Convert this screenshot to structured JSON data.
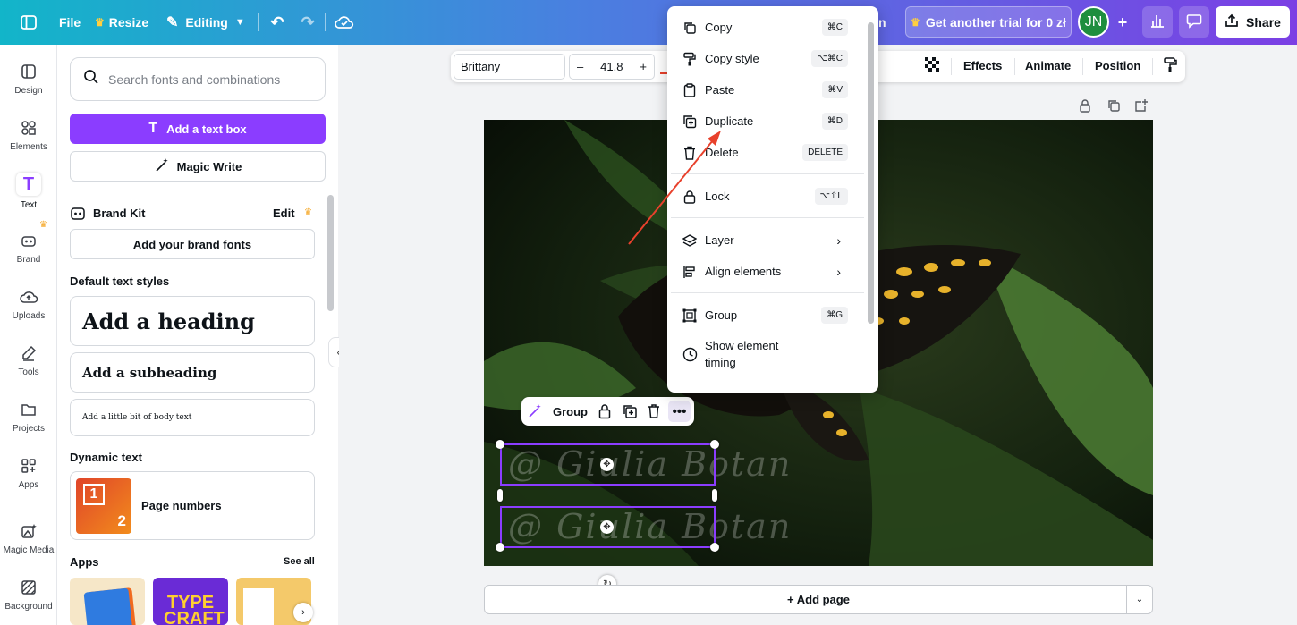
{
  "topbar": {
    "file": "File",
    "resize": "Resize",
    "editing": "Editing",
    "partial_text": "n",
    "trial": "Get another trial for 0 zł",
    "avatar": "JN",
    "share": "Share"
  },
  "rail": [
    {
      "label": "Design",
      "icon": "design-icon"
    },
    {
      "label": "Elements",
      "icon": "elements-icon"
    },
    {
      "label": "Text",
      "icon": "text-icon"
    },
    {
      "label": "Brand",
      "icon": "brand-icon"
    },
    {
      "label": "Uploads",
      "icon": "uploads-icon"
    },
    {
      "label": "Tools",
      "icon": "tools-icon"
    },
    {
      "label": "Projects",
      "icon": "projects-icon"
    },
    {
      "label": "Apps",
      "icon": "apps-icon"
    },
    {
      "label": "Magic Media",
      "icon": "magic-media-icon"
    },
    {
      "label": "Background",
      "icon": "background-icon"
    }
  ],
  "panel": {
    "search_placeholder": "Search fonts and combinations",
    "add_text_box": "Add a text box",
    "magic_write": "Magic Write",
    "brand_kit": "Brand Kit",
    "edit": "Edit",
    "add_brand_fonts": "Add your brand fonts",
    "default_styles": "Default text styles",
    "heading": "Add a heading",
    "subheading": "Add a subheading",
    "body": "Add a little bit of body text",
    "dynamic_text": "Dynamic text",
    "page_numbers": "Page numbers",
    "page_thumb_1": "1",
    "page_thumb_2": "2",
    "apps": "Apps",
    "see_all": "See all",
    "app_thumb_2": "TYPE CRAFT"
  },
  "toolbar": {
    "font": "Brittany",
    "minus": "–",
    "size": "41.8",
    "plus": "+",
    "effects": "Effects",
    "animate": "Animate",
    "position": "Position"
  },
  "menu": {
    "items": [
      {
        "label": "Copy",
        "shortcut": "⌘C"
      },
      {
        "label": "Copy style",
        "shortcut": "⌥⌘C"
      },
      {
        "label": "Paste",
        "shortcut": "⌘V"
      },
      {
        "label": "Duplicate",
        "shortcut": "⌘D"
      },
      {
        "label": "Delete",
        "shortcut": "DELETE"
      },
      {
        "label": "Lock",
        "shortcut": "⌥⇧L"
      },
      {
        "label": "Layer",
        "shortcut": ""
      },
      {
        "label": "Align elements",
        "shortcut": ""
      },
      {
        "label": "Group",
        "shortcut": "⌘G"
      },
      {
        "label": "Show element timing",
        "shortcut": ""
      }
    ]
  },
  "floatbar": {
    "group": "Group"
  },
  "canvas": {
    "script_text": "@ Giulia Botan",
    "add_page": "+ Add page"
  },
  "colors": {
    "accent": "#8b3dff",
    "topbar_start": "#12b5c9",
    "topbar_end": "#7b3fe4",
    "avatar": "#1e8e3e",
    "annotation_arrow": "#e8412c"
  }
}
